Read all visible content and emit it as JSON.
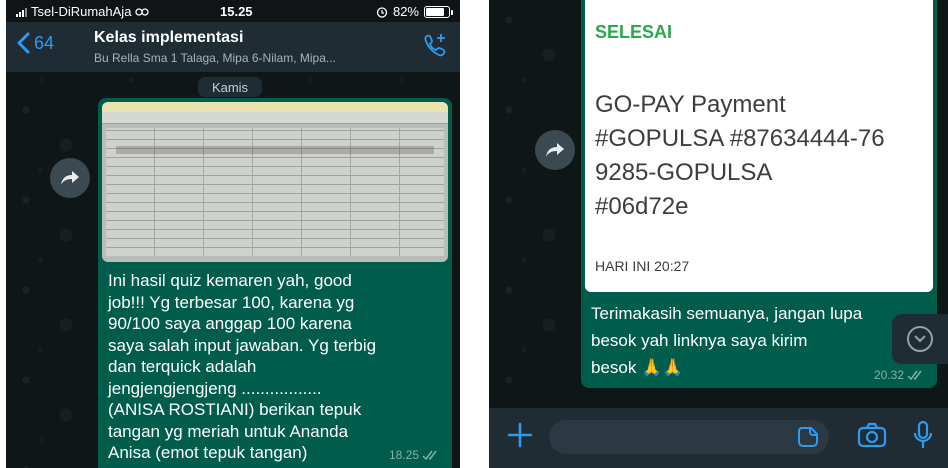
{
  "left_screen": {
    "status_bar": {
      "carrier": "Tsel-DiRumahAja",
      "time": "15.25",
      "battery": "82%"
    },
    "header": {
      "back_count": "64",
      "title": "Kelas implementasi",
      "subtitle": "Bu Rella Sma 1 Talaga, Mipa 6-Nilam, Mipa..."
    },
    "day_label": "Kamis",
    "message": {
      "text": "Ini hasil quiz kemaren yah, good\njob!!! Yg terbesar 100, karena yg\n90/100 saya anggap 100 karena\nsaya salah input jawaban. Yg terbig\ndan terquick adalah\njengjengjengjeng .................\n(ANISA ROSTIANI) berikan tepuk\ntangan yg meriah untuk Ananda\nAnisa (emot tepuk tangan)",
      "time": "18.25"
    }
  },
  "right_screen": {
    "receipt": {
      "status": "SELESAI",
      "body": "GO-PAY Payment\n#GOPULSA #87634444-76\n9285-GOPULSA\n#06d72e",
      "time": "HARI INI 20:27"
    },
    "message": {
      "text": "Terimakasih semuanya, jangan lupa\nbesok yah linknya saya kirim\nbesok ",
      "emoji": "🙏🙏",
      "time": "20.32"
    }
  },
  "colors": {
    "chat_bg": "#0f1618",
    "header_bg": "#1f2c33",
    "outgoing_bubble": "#005c4b",
    "accent_blue": "#2f9bf0",
    "status_green": "#2aa84a"
  },
  "icons": [
    "back-chevron-icon",
    "call-add-icon",
    "forward-icon",
    "double-check-icon",
    "plus-icon",
    "sticker-icon",
    "camera-icon",
    "mic-icon",
    "chevron-down-icon"
  ]
}
